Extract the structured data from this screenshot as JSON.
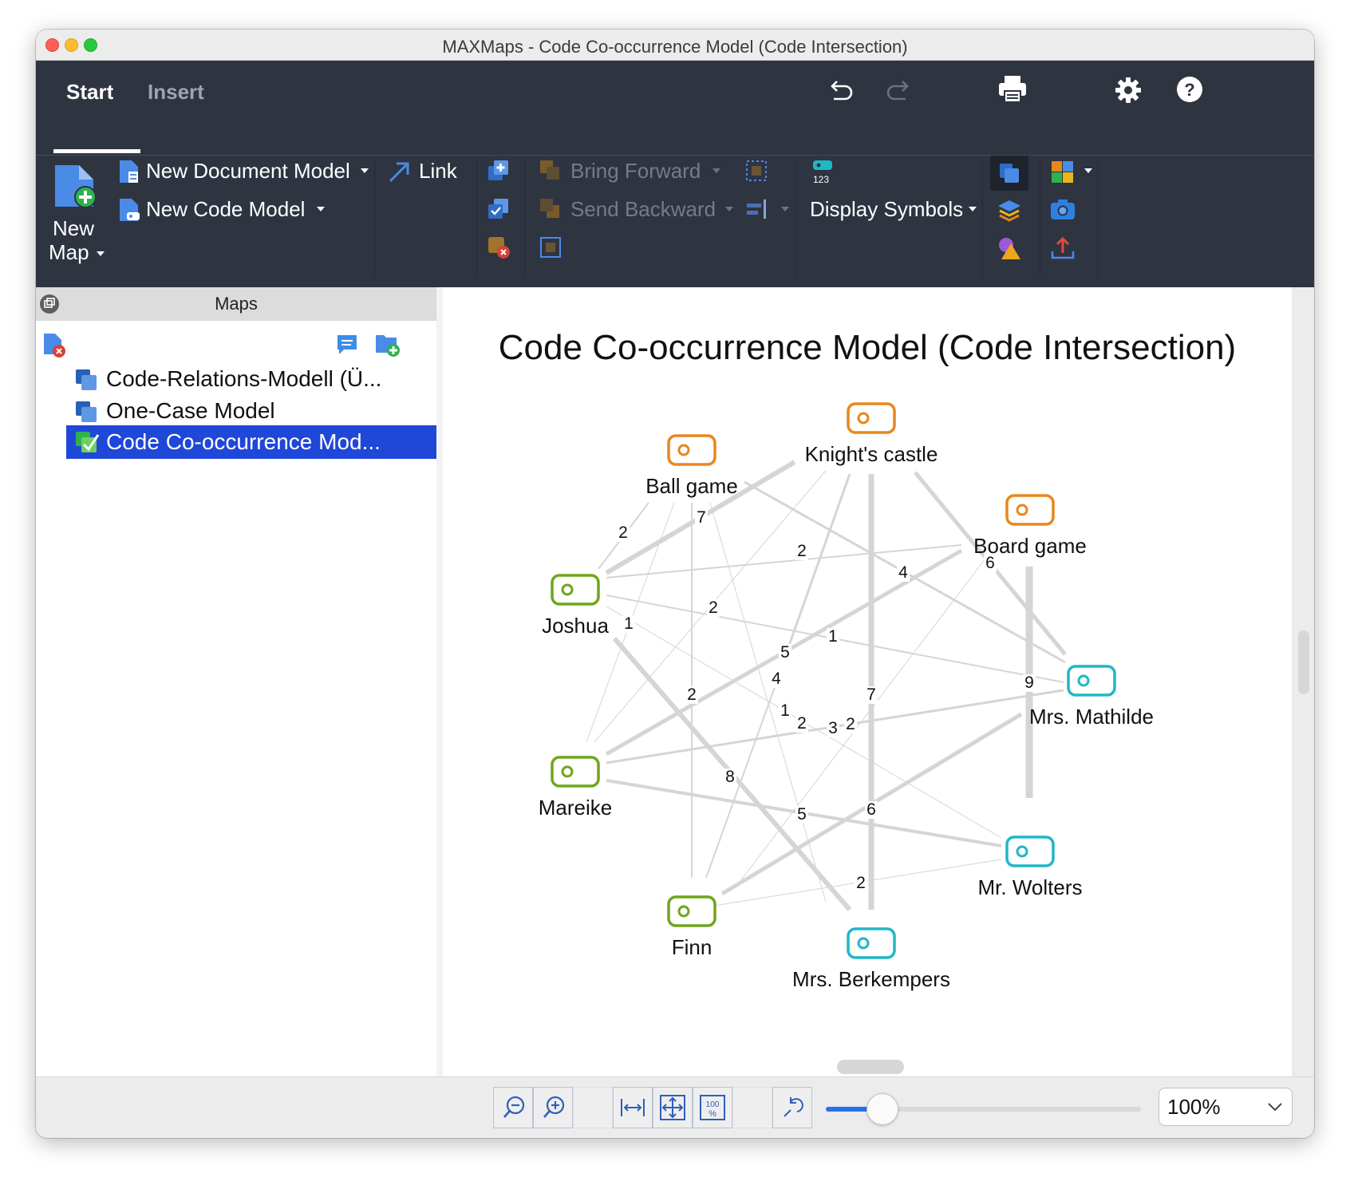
{
  "window": {
    "title": "MAXMaps - Code Co-occurrence Model (Code Intersection)"
  },
  "ribbon": {
    "tabs": [
      {
        "label": "Start",
        "active": true
      },
      {
        "label": "Insert",
        "active": false
      }
    ],
    "new_map_line1": "New",
    "new_map_line2": "Map",
    "new_document_model": "New Document Model",
    "new_code_model": "New Code Model",
    "link": "Link",
    "bring_forward": "Bring Forward",
    "send_backward": "Send Backward",
    "display_symbols": "Display Symbols",
    "symbols_badge": "123"
  },
  "sidebar": {
    "header": "Maps",
    "items": [
      {
        "label": "Code-Relations-Modell (Ü..."
      },
      {
        "label": "One-Case Model"
      },
      {
        "label": "Code Co-occurrence Mod...",
        "selected": true
      }
    ]
  },
  "map": {
    "title": "Code Co-occurrence Model (Code Intersection)",
    "colors": {
      "orange": "#e8871d",
      "green": "#6fa61b",
      "teal": "#1fb7c7",
      "edge": "#d5d5d5"
    },
    "nodes": [
      {
        "id": "knights",
        "label": "Knight's castle",
        "color": "orange"
      },
      {
        "id": "ball",
        "label": "Ball game",
        "color": "orange"
      },
      {
        "id": "board",
        "label": "Board game",
        "color": "orange"
      },
      {
        "id": "joshua",
        "label": "Joshua",
        "color": "green"
      },
      {
        "id": "mathilde",
        "label": "Mrs. Mathilde",
        "color": "teal"
      },
      {
        "id": "mareike",
        "label": "Mareike",
        "color": "green"
      },
      {
        "id": "wolters",
        "label": "Mr. Wolters",
        "color": "teal"
      },
      {
        "id": "finn",
        "label": "Finn",
        "color": "green"
      },
      {
        "id": "berkempers",
        "label": "Mrs. Berkempers",
        "color": "teal"
      }
    ],
    "edge_labels": [
      "2",
      "7",
      "2",
      "4",
      "6",
      "2",
      "1",
      "1",
      "5",
      "4",
      "9",
      "2",
      "7",
      "1",
      "2",
      "3",
      "2",
      "8",
      "6",
      "5",
      "2"
    ]
  },
  "statusbar": {
    "zoom_value": "100%",
    "zoom_level": 0.18
  }
}
